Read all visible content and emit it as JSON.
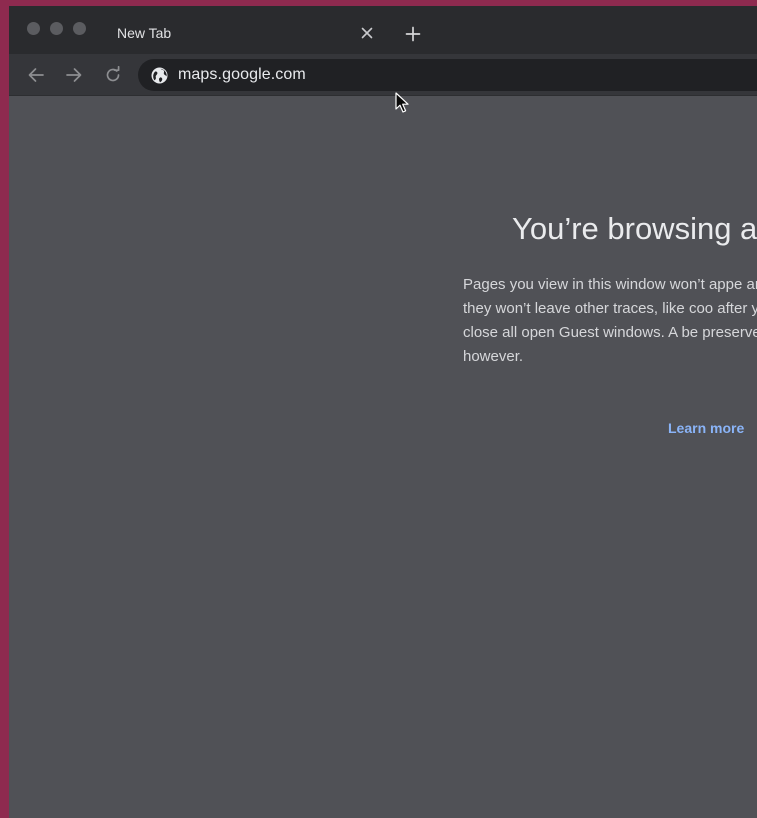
{
  "window": {
    "controls": [
      "close",
      "minimize",
      "zoom"
    ]
  },
  "tabs": [
    {
      "title": "New Tab",
      "close_icon": "close-icon"
    }
  ],
  "toolbar": {
    "back_icon": "arrow-left-icon",
    "forward_icon": "arrow-right-icon",
    "reload_icon": "reload-icon",
    "site_icon": "globe-icon",
    "url": "maps.google.com"
  },
  "guest_page": {
    "heading": "You’re browsing a",
    "description": "Pages you view in this window won’t appe and they won’t leave other traces, like coo after you close all open Guest windows. A be preserved, however.",
    "learn_more": "Learn more"
  },
  "colors": {
    "frame_border": "#8e2a4f",
    "tabstrip": "#2a2b2e",
    "toolbar": "#35363a",
    "omnibox": "#202124",
    "content_bg": "#505156",
    "link": "#8ab4f8"
  }
}
